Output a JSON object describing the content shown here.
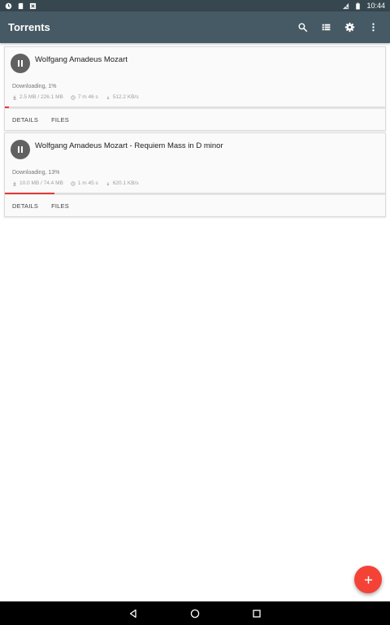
{
  "status_bar": {
    "time": "10:44",
    "left_icons": [
      "sync-icon",
      "sd-card-icon",
      "download-notification-icon"
    ],
    "right_icons": [
      "signal-off-icon",
      "battery-icon"
    ]
  },
  "app_bar": {
    "title": "Torrents",
    "actions": [
      "search-icon",
      "view-list-icon",
      "settings-icon",
      "more-vert-icon"
    ]
  },
  "torrents": [
    {
      "name": "Wolfgang Amadeus Mozart",
      "status": "Downloading, 1%",
      "progress": 0.01,
      "size": "2.5 MB / 226.1 MB",
      "eta": "7 m 46 s",
      "speed": "512.2 KB/s",
      "details_label": "DETAILS",
      "files_label": "FILES"
    },
    {
      "name": "Wolfgang Amadeus Mozart -  Requiem Mass in D minor",
      "status": "Downloading, 13%",
      "progress": 0.13,
      "size": "10.0 MB / 74.4 MB",
      "eta": "1 m 45 s",
      "speed": "620.1 KB/s",
      "details_label": "DETAILS",
      "files_label": "FILES"
    }
  ],
  "fab": {
    "icon": "add-icon"
  },
  "nav_bar": {
    "buttons": [
      "back-icon",
      "home-icon",
      "recents-icon"
    ]
  },
  "colors": {
    "app_bar": "#455a64",
    "status_bar": "#37474f",
    "accent": "#f44336",
    "progress": "#e53935"
  }
}
